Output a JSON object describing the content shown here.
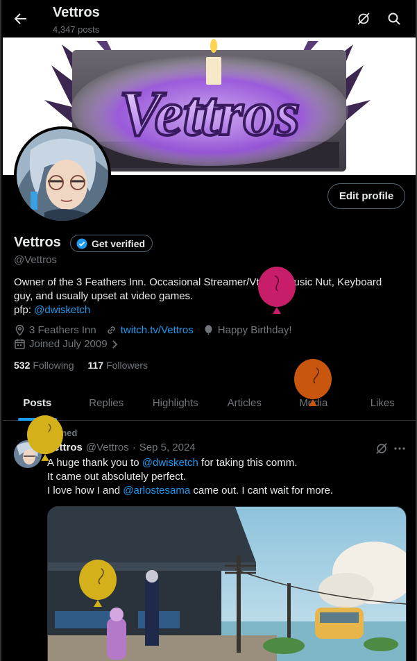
{
  "header": {
    "title": "Vettros",
    "post_count": "4,347 posts"
  },
  "banner": {
    "logo_text": "Vettros"
  },
  "profile": {
    "edit_label": "Edit profile",
    "name": "Vettros",
    "verify_label": "Get verified",
    "handle": "@Vettros",
    "bio_line1": "Owner of the 3 Feathers Inn. Occasional Streamer/Vtuber. Music Nut, Keyboard",
    "bio_line2": "guy, and usually upset at video games.",
    "bio_pfp_prefix": "pfp: ",
    "bio_pfp_link": "@dwisketch",
    "location": "3 Feathers Inn",
    "website": "twitch.tv/Vettros",
    "birthday": "Happy Birthday!",
    "joined": "Joined July 2009",
    "following_count": "532",
    "following_label": "Following",
    "followers_count": "117",
    "followers_label": "Followers"
  },
  "tabs": [
    {
      "label": "Posts",
      "active": true
    },
    {
      "label": "Replies"
    },
    {
      "label": "Highlights"
    },
    {
      "label": "Articles"
    },
    {
      "label": "Media"
    },
    {
      "label": "Likes"
    }
  ],
  "tweet": {
    "pinned_label": "Pinned",
    "author": "Vettros",
    "handle": "@Vettros",
    "separator": "·",
    "date": "Sep 5, 2024",
    "line1_pre": "A huge thank you to ",
    "line1_link": "@dwisketch",
    "line1_post": " for taking this comm.",
    "line2": "It came out absolutely perfect.",
    "line3_pre": "I love how I and ",
    "line3_link": "@arlostesama",
    "line3_post": " came out. I cant wait for more."
  },
  "colors": {
    "accent": "#1d9bf0",
    "balloon_pink": "#c81e6a",
    "balloon_orange": "#c8560f",
    "balloon_yellow": "#d4b01a"
  },
  "icons": [
    "back-arrow-icon",
    "grok-icon",
    "search-icon",
    "verified-badge-icon",
    "location-icon",
    "link-icon",
    "balloon-icon",
    "calendar-icon",
    "chevron-right-icon",
    "pin-icon",
    "more-icon"
  ]
}
